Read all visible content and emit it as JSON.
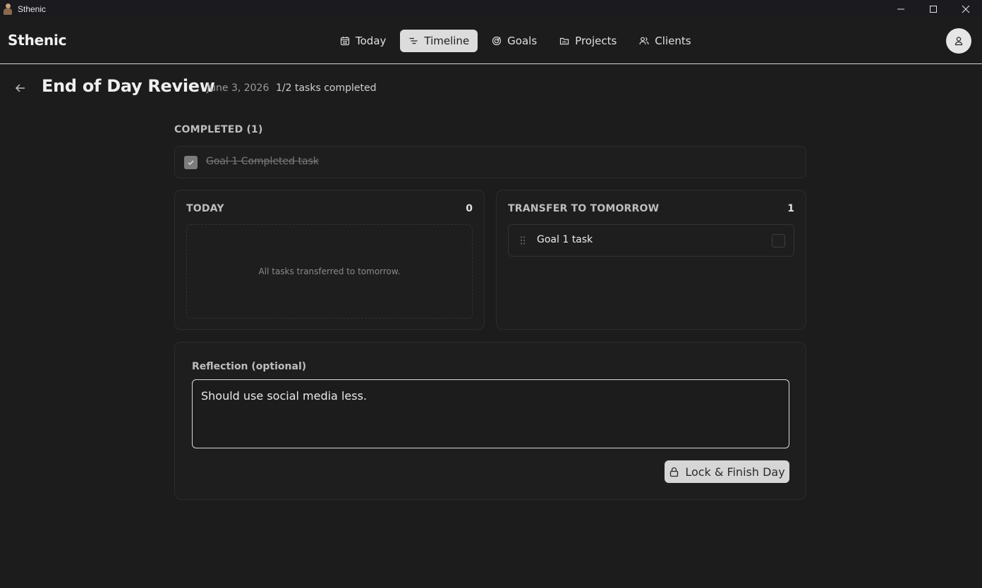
{
  "window": {
    "title": "Sthenic"
  },
  "header": {
    "brand": "Sthenic",
    "nav": [
      {
        "label": "Today",
        "icon": "calendar-icon",
        "active": false
      },
      {
        "label": "Timeline",
        "icon": "timeline-icon",
        "active": true
      },
      {
        "label": "Goals",
        "icon": "target-icon",
        "active": false
      },
      {
        "label": "Projects",
        "icon": "folder-icon",
        "active": false
      },
      {
        "label": "Clients",
        "icon": "users-icon",
        "active": false
      }
    ]
  },
  "page": {
    "title": "End of Day Review",
    "date": "June 3, 2026",
    "progress": "1/2 tasks completed"
  },
  "completed": {
    "label": "COMPLETED (1)",
    "items": [
      {
        "title": "Goal 1 Completed task",
        "done": true
      }
    ]
  },
  "today": {
    "label": "TODAY",
    "count": "0",
    "empty_text": "All tasks transferred to tomorrow."
  },
  "tomorrow": {
    "label": "TRANSFER TO TOMORROW",
    "count": "1",
    "items": [
      {
        "title": "Goal 1 task",
        "done": false
      }
    ]
  },
  "reflection": {
    "label": "Reflection (optional)",
    "value": "Should use social media less.",
    "button_label": "Lock & Finish Day"
  },
  "colors": {
    "accent": "#dcdcdc",
    "background": "#1c1c1c",
    "card": "#1e1e1e"
  }
}
